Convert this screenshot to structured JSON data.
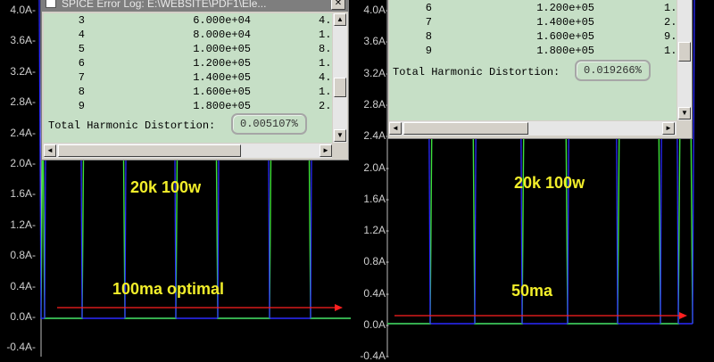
{
  "left_pane": {
    "y_ticks": [
      "4.0A-",
      "3.6A-",
      "3.2A-",
      "2.8A-",
      "2.4A-",
      "2.0A-",
      "1.6A-",
      "1.2A-",
      "0.8A-",
      "0.4A-",
      "0.0A-",
      "-0.4A-"
    ],
    "label_title": "20k 100w",
    "label_note": "100ma optimal"
  },
  "right_pane": {
    "y_ticks": [
      "4.0A-",
      "3.6A-",
      "3.2A-",
      "2.8A-",
      "2.4A-",
      "2.0A-",
      "1.6A-",
      "1.2A-",
      "0.8A-",
      "0.4A-",
      "0.0A-",
      "-0.4A-"
    ],
    "label_title": "20k 100w",
    "label_note": "50ma"
  },
  "left_window": {
    "title": "SPICE Error Log: E:\\WEBSITE\\PDF1\\Ele...",
    "rows": [
      {
        "n": "3",
        "freq": "6.000e+04",
        "mag": "4."
      },
      {
        "n": "4",
        "freq": "8.000e+04",
        "mag": "1."
      },
      {
        "n": "5",
        "freq": "1.000e+05",
        "mag": "8."
      },
      {
        "n": "6",
        "freq": "1.200e+05",
        "mag": "1."
      },
      {
        "n": "7",
        "freq": "1.400e+05",
        "mag": "4."
      },
      {
        "n": "8",
        "freq": "1.600e+05",
        "mag": "1."
      },
      {
        "n": "9",
        "freq": "1.800e+05",
        "mag": "2."
      }
    ],
    "thd_label": "Total Harmonic Distortion:",
    "thd_value": "0.005107%"
  },
  "right_window": {
    "rows": [
      {
        "n": "6",
        "freq": "1.200e+05",
        "mag": "1."
      },
      {
        "n": "7",
        "freq": "1.400e+05",
        "mag": "2."
      },
      {
        "n": "8",
        "freq": "1.600e+05",
        "mag": "9."
      },
      {
        "n": "9",
        "freq": "1.800e+05",
        "mag": "1."
      }
    ],
    "thd_label": "Total Harmonic Distortion:",
    "thd_value": "0.019266%"
  },
  "colors": {
    "trace_green": "#3ee03e",
    "trace_blue": "#2a2aff",
    "arrow_red": "#ff2020",
    "label_yellow": "#f2ee2a"
  },
  "icons": {
    "scroll_up": "▲",
    "scroll_down": "▼",
    "scroll_left": "◄",
    "scroll_right": "►",
    "close": "✕"
  }
}
